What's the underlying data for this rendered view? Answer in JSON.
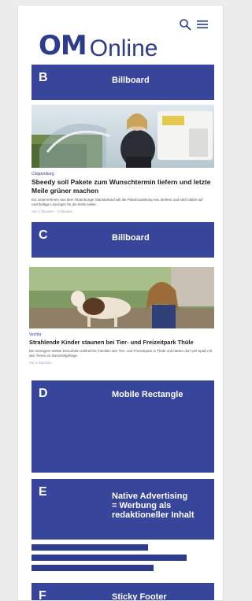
{
  "header": {
    "logo_bold": "OM",
    "logo_light": "Online",
    "search_icon": "search-icon",
    "menu_icon": "hamburger-menu-icon"
  },
  "colors": {
    "brand": "#2d3c8c",
    "ad_fill": "#37459a",
    "page_bg": "#ececec"
  },
  "ads": [
    {
      "letter": "B",
      "label": "Billboard"
    },
    {
      "letter": "C",
      "label": "Billboard"
    },
    {
      "letter": "D",
      "label": "Mobile Rectangle"
    },
    {
      "letter": "E",
      "label": "Native Advertising\n= Werbung als\nredaktioneller Inhalt"
    },
    {
      "letter": "F",
      "label": "Sticky Footer"
    }
  ],
  "articles": [
    {
      "kicker": "Cloppenburg",
      "headline": "Sbeedy soll Pakete zum Wunschtermin liefern und letzte Meile grüner machen",
      "teaser": "Ein Unternehmen aus dem Oldenburger Münsterland will die Paketzustellung neu denken und setzt dabei auf nachhaltige Lösungen für die letzte Meile.",
      "meta": "Vor 2 Stunden · 3 Minuten"
    },
    {
      "kicker": "Vechta",
      "headline": "Strahlende Kinder staunen bei Tier- und Freizeitpark Thüle",
      "teaser": "Bei sonnigem Wetter besuchten zahlreiche Familien den Tier- und Freizeitpark in Thüle und hatten dort viel Spaß mit den Tieren im Streichelgehege.",
      "meta": "Vor 4 Stunden"
    }
  ]
}
